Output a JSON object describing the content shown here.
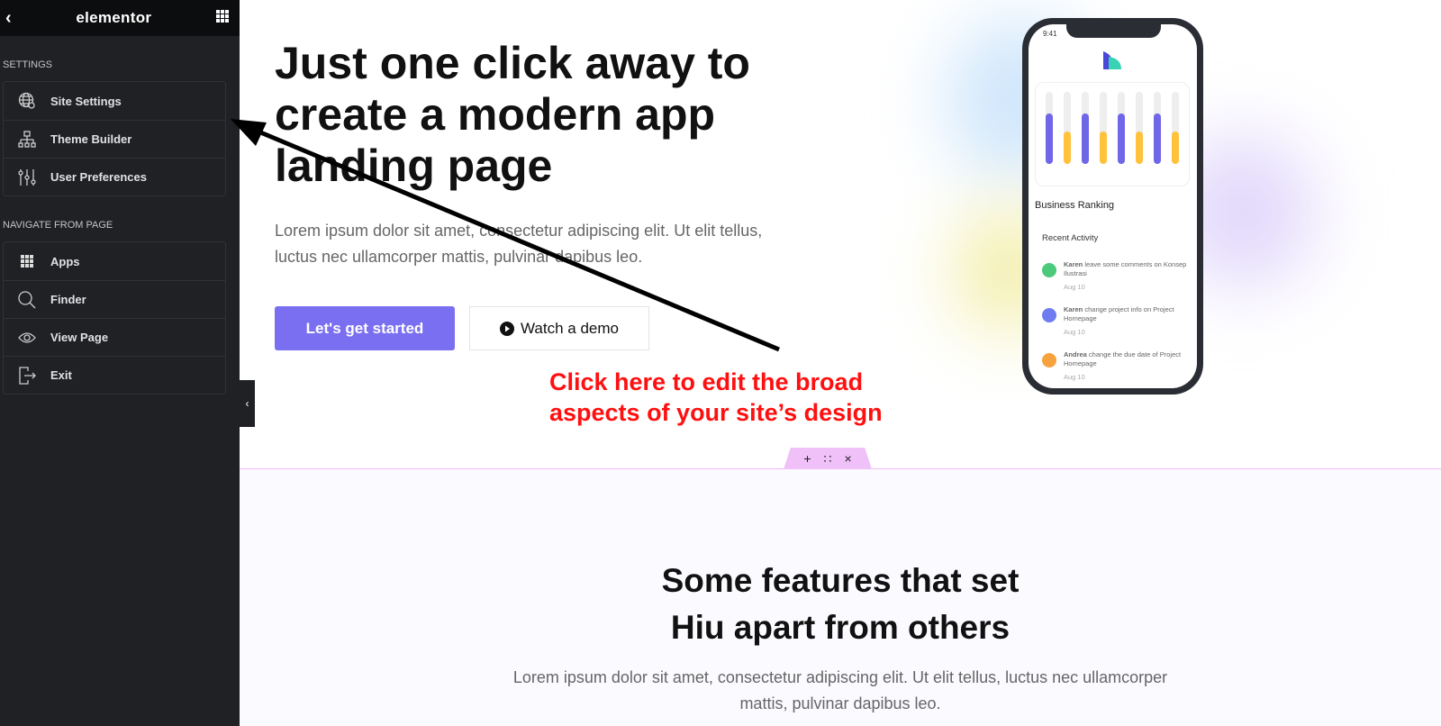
{
  "sidebar": {
    "logo": "elementor",
    "settings_heading": "SETTINGS",
    "settings_items": [
      {
        "label": "Site Settings",
        "icon": "globe-gear-icon"
      },
      {
        "label": "Theme Builder",
        "icon": "sitemap-icon"
      },
      {
        "label": "User Preferences",
        "icon": "sliders-icon"
      }
    ],
    "navigate_heading": "NAVIGATE FROM PAGE",
    "navigate_items": [
      {
        "label": "Apps",
        "icon": "grid-icon"
      },
      {
        "label": "Finder",
        "icon": "search-icon"
      },
      {
        "label": "View Page",
        "icon": "eye-icon"
      },
      {
        "label": "Exit",
        "icon": "exit-icon"
      }
    ]
  },
  "hero": {
    "title": "Just one click away to create a modern app landing page",
    "text": "Lorem ipsum dolor sit amet, consectetur adipiscing elit. Ut elit tellus, luctus nec ullamcorper mattis, pulvinar dapibus leo.",
    "primary_button": "Let's get started",
    "secondary_button": "Watch a demo"
  },
  "annotation": {
    "line1": "Click here to edit the broad",
    "line2": "aspects of your site’s design",
    "color": "#ff1010"
  },
  "phone": {
    "time": "9:41",
    "chart_title": "Business Ranking",
    "activity_title": "Recent Activity",
    "bars": [
      0.7,
      0.45,
      0.7,
      0.45,
      0.7,
      0.45,
      0.7,
      0.45
    ],
    "bar_colors": [
      "#6f66e8",
      "#ffc23a"
    ],
    "activities": [
      {
        "name": "Karen",
        "text": " leave some comments on Konsep Ilustrasi",
        "date": "Aug 10",
        "color": "#4cc97a"
      },
      {
        "name": "Karen",
        "text": " change project info on Project Homepage",
        "date": "Aug 10",
        "color": "#6f7cf0"
      },
      {
        "name": "Andrea",
        "text": " change the due date of Project Homepage",
        "date": "Aug 10",
        "color": "#f7a23c"
      }
    ]
  },
  "section_handle": {
    "add": "+",
    "drag": "∷",
    "close": "×"
  },
  "features": {
    "title_line1": "Some features that set",
    "title_line2": "Hiu apart from others",
    "text": "Lorem ipsum dolor sit amet, consectetur adipiscing elit. Ut elit tellus, luctus nec ullamcorper mattis, pulvinar dapibus leo."
  },
  "colors": {
    "accent": "#7a6ff0",
    "sidebar_bg": "#1f2124"
  }
}
